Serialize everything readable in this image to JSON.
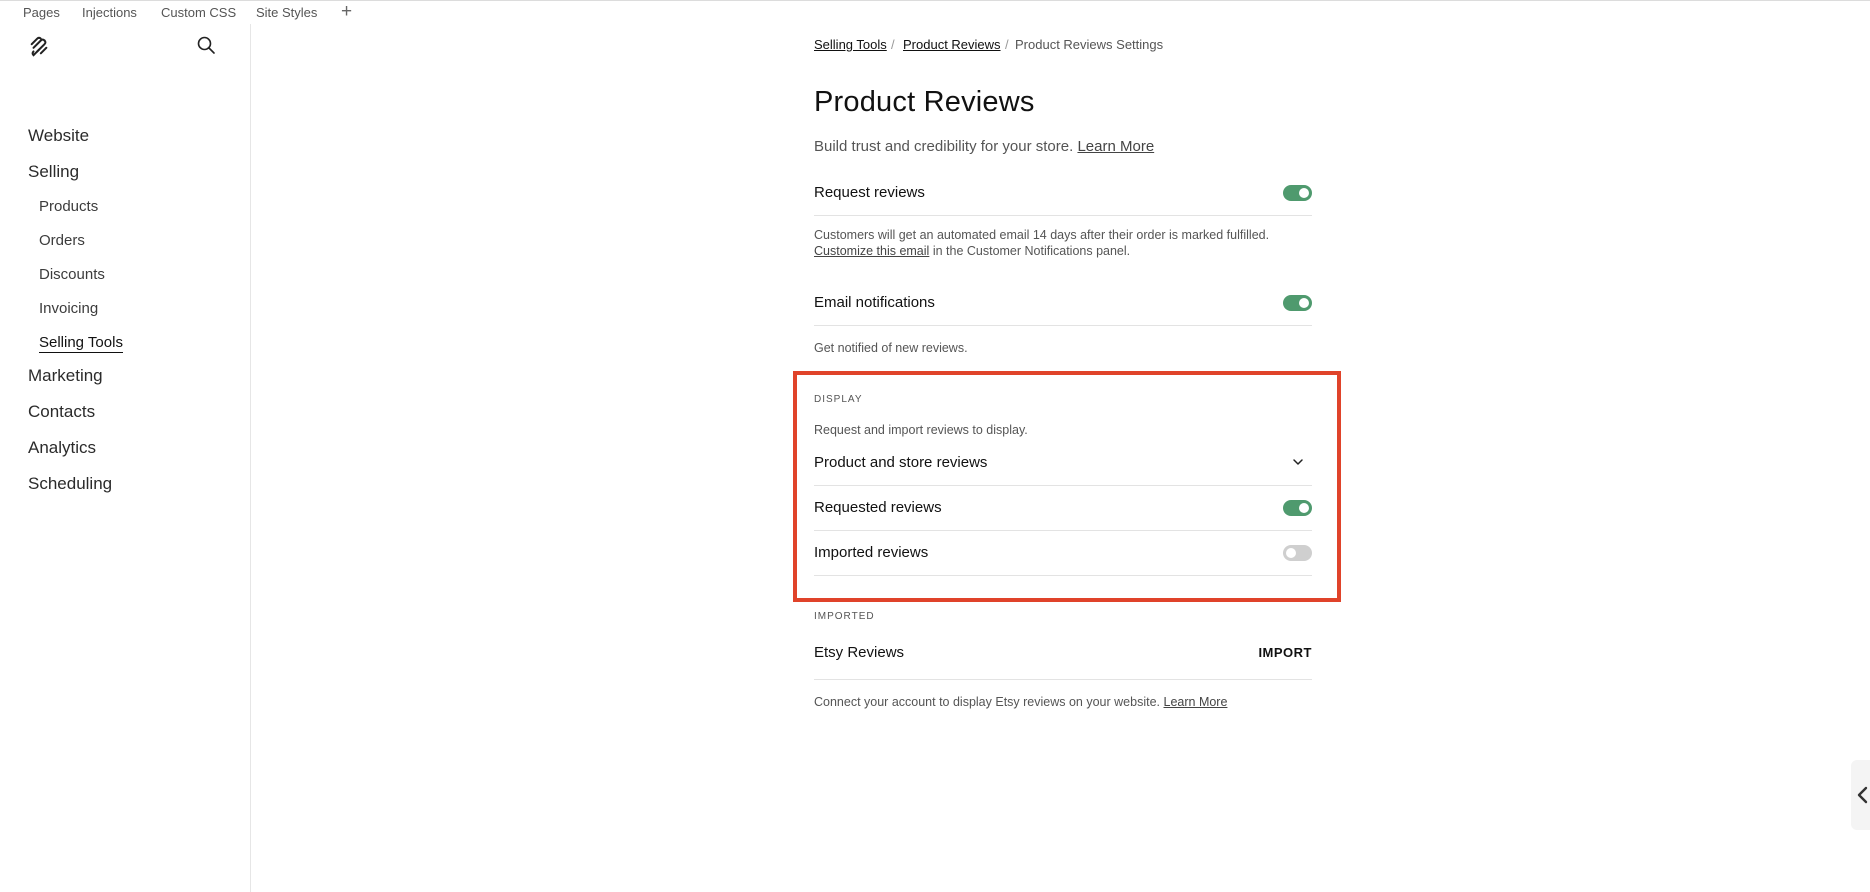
{
  "top_tabs": [
    "Pages",
    "Injections",
    "Custom CSS",
    "Site Styles"
  ],
  "sidebar": {
    "main_items": [
      "Website",
      "Selling",
      "Marketing",
      "Contacts",
      "Analytics",
      "Scheduling"
    ],
    "selling_sub_items": [
      "Products",
      "Orders",
      "Discounts",
      "Invoicing",
      "Selling Tools"
    ],
    "active_item": "Selling Tools"
  },
  "breadcrumb": {
    "items": [
      "Selling Tools",
      "Product Reviews",
      "Product Reviews Settings"
    ],
    "separator": "/"
  },
  "page": {
    "title": "Product Reviews",
    "description": "Build trust and credibility for your store.",
    "learn_more": "Learn More"
  },
  "request_reviews": {
    "label": "Request reviews",
    "enabled": true,
    "note_line1": "Customers will get an automated email 14 days after their order is marked fulfilled.",
    "note_link": "Customize this email",
    "note_rest": "in the Customer Notifications panel."
  },
  "email_notifications": {
    "label": "Email notifications",
    "enabled": true,
    "note": "Get notified of new reviews."
  },
  "display": {
    "section_title": "DISPLAY",
    "description": "Request and import reviews to display.",
    "select_value": "Product and store reviews",
    "requested_label": "Requested reviews",
    "requested_enabled": true,
    "imported_label": "Imported reviews",
    "imported_enabled": false
  },
  "imported": {
    "section_title": "IMPORTED",
    "etsy_label": "Etsy Reviews",
    "import_button": "IMPORT",
    "note": "Connect your account to display Etsy reviews on your website.",
    "learn_more": "Learn More"
  },
  "colors": {
    "toggle_on": "#4f9a6e",
    "toggle_off": "#cfcfcf",
    "highlight": "#e0432a"
  }
}
